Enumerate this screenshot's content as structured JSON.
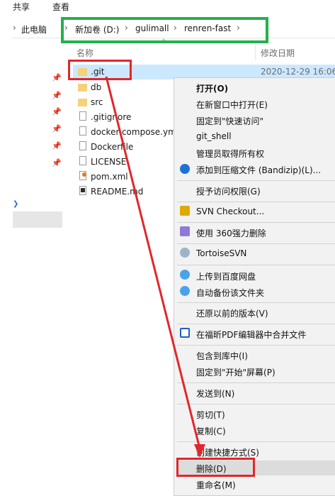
{
  "ribbon": {
    "tabs": [
      "共享",
      "查看"
    ]
  },
  "breadcrumb": [
    "此电脑",
    "新加卷 (D:)",
    "gulimall",
    "renren-fast"
  ],
  "columns": {
    "name": "名称",
    "modified": "修改日期"
  },
  "files": [
    {
      "name": ".git",
      "type": "folder",
      "date": "2020-12-29 16:06"
    },
    {
      "name": "db",
      "type": "folder"
    },
    {
      "name": "src",
      "type": "folder"
    },
    {
      "name": ".gitignore",
      "type": "file"
    },
    {
      "name": "docker-compose.yml",
      "type": "file"
    },
    {
      "name": "Dockerfile",
      "type": "file"
    },
    {
      "name": "LICENSE",
      "type": "file"
    },
    {
      "name": "pom.xml",
      "type": "xml"
    },
    {
      "name": "README.md",
      "type": "md"
    }
  ],
  "context_menu": [
    {
      "label": "打开(O)",
      "bold": true
    },
    {
      "label": "在新窗口中打开(E)"
    },
    {
      "label": "固定到\"快速访问\""
    },
    {
      "label": "git_shell"
    },
    {
      "label": "管理员取得所有权"
    },
    {
      "label": "添加到压缩文件 (Bandizip)(L)...",
      "icon": "bandizip-icon"
    },
    {
      "label": "授予访问权限(G)"
    },
    {
      "label": "SVN Checkout...",
      "icon": "svn-checkout-icon"
    },
    {
      "label": "使用 360强力删除",
      "icon": "360-icon"
    },
    {
      "label": "TortoiseSVN",
      "icon": "tortoisesvn-icon"
    },
    {
      "label": "上传到百度网盘",
      "icon": "baidu-netdisk-icon"
    },
    {
      "label": "自动备份该文件夹",
      "icon": "baidu-netdisk-icon"
    },
    {
      "label": "还原以前的版本(V)"
    },
    {
      "label": "在福昕PDF编辑器中合并文件",
      "icon": "foxit-pdf-icon"
    },
    {
      "label": "包含到库中(I)"
    },
    {
      "label": "固定到\"开始\"屏幕(P)"
    },
    {
      "label": "发送到(N)"
    },
    {
      "label": "剪切(T)"
    },
    {
      "label": "复制(C)"
    },
    {
      "label": "创建快捷方式(S)"
    },
    {
      "label": "删除(D)",
      "highlighted": true
    },
    {
      "label": "重命名(M)"
    }
  ],
  "colors": {
    "selection": "#cce8ff",
    "annotation_red": "#e3262c",
    "annotation_green": "#22b14c",
    "folder": "#f3d27a"
  }
}
